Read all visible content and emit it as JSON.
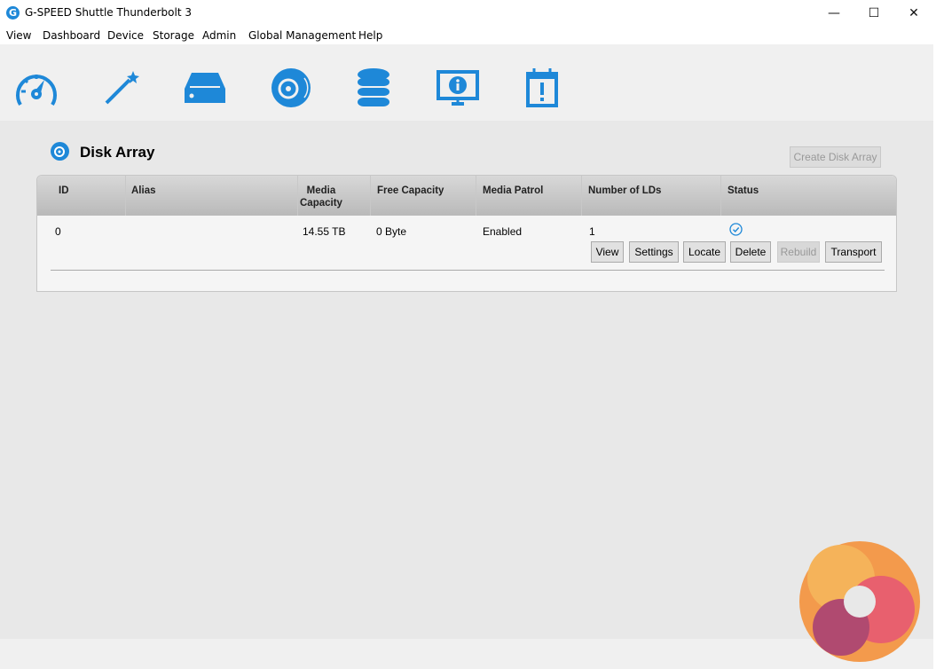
{
  "window": {
    "title": "G-SPEED Shuttle Thunderbolt 3",
    "app_icon": "G",
    "minimize": "—",
    "maximize": "☐",
    "close": "✕"
  },
  "menu": [
    "View",
    "Dashboard",
    "Device",
    "Storage",
    "Admin",
    "Global Management",
    "Help"
  ],
  "toolbar": [
    "dashboard-gauge-icon",
    "wizard-wand-icon",
    "device-drive-icon",
    "disk-array-icon",
    "storage-database-icon",
    "info-monitor-icon",
    "event-calendar-icon"
  ],
  "page": {
    "title": "Disk Array",
    "create_button": "Create Disk Array"
  },
  "table": {
    "headers": [
      "ID",
      "Alias",
      "Media\nCapacity",
      "Free Capacity",
      "Media Patrol",
      "Number of LDs",
      "Status"
    ],
    "rows": [
      {
        "id": "0",
        "alias": "",
        "media_capacity": "14.55 TB",
        "free_capacity": "0 Byte",
        "media_patrol": "Enabled",
        "num_lds": "1",
        "status": "ok"
      }
    ],
    "actions": [
      "View",
      "Settings",
      "Locate",
      "Delete",
      "Rebuild",
      "Transport"
    ]
  },
  "colors": {
    "accent": "#1e88d8"
  }
}
